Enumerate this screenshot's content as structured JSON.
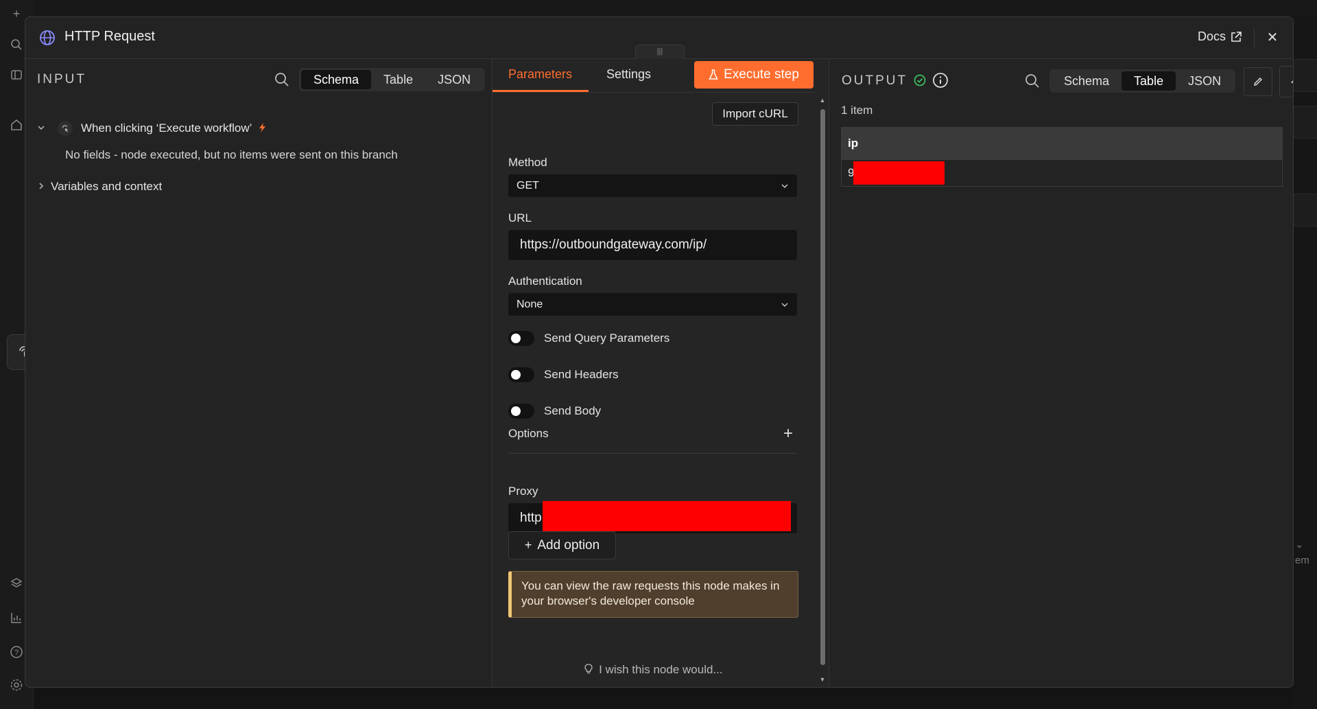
{
  "background": {
    "right_clip_text": "em"
  },
  "modal": {
    "title": "HTTP Request",
    "docs_label": "Docs",
    "close_glyph": "✕"
  },
  "input": {
    "label": "INPUT",
    "view_tabs": [
      "Schema",
      "Table",
      "JSON"
    ],
    "active_tab": "Schema",
    "trigger_node": "When clicking ‘Execute workflow’",
    "no_fields_note": "No fields - node executed, but no items were sent on this branch",
    "variables_label": "Variables and context"
  },
  "parameters": {
    "tabs": [
      "Parameters",
      "Settings"
    ],
    "active_tab": "Parameters",
    "execute_label": "Execute step",
    "import_curl_label": "Import cURL",
    "method_label": "Method",
    "method_value": "GET",
    "url_label": "URL",
    "url_value": "https://outboundgateway.com/ip/",
    "auth_label": "Authentication",
    "auth_value": "None",
    "toggles": [
      "Send Query Parameters",
      "Send Headers",
      "Send Body"
    ],
    "options_label": "Options",
    "proxy_label": "Proxy",
    "proxy_value_visible": "http",
    "add_option_label": "Add option",
    "callout_text": "You can view the raw requests this node makes in your browser's developer console",
    "wish_label": "I wish this node would..."
  },
  "output": {
    "label": "OUTPUT",
    "view_tabs": [
      "Schema",
      "Table",
      "JSON"
    ],
    "active_tab": "Table",
    "items_count": "1 item",
    "table": {
      "columns": [
        "ip"
      ],
      "rows": [
        [
          "9"
        ]
      ]
    }
  },
  "colors": {
    "accent": "#ff6d2e",
    "success": "#3dbb61",
    "redaction": "#ff0000",
    "callout_border": "#f0c674"
  }
}
